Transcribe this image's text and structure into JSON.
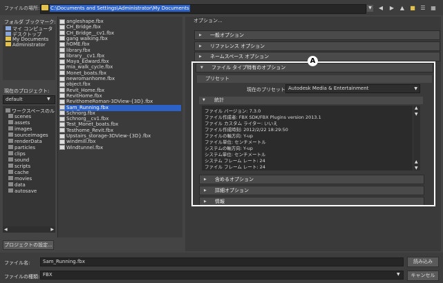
{
  "top": {
    "location_label": "ファイルの場所:",
    "path": "C:\\Documents and Settings\\Administrator\\My Documents"
  },
  "bookmarks": {
    "label": "フォルダ ブックマーク:",
    "items": [
      "マイ コンピュータ",
      "デスクトップ",
      "My Documents",
      "Administrator"
    ]
  },
  "project": {
    "label": "現在のプロジェクト:",
    "selected": "default",
    "tree": [
      "ワークスペースのル",
      "scenes",
      "assets",
      "images",
      "sourceimages",
      "renderData",
      "particles",
      "clips",
      "sound",
      "scripts",
      "cache",
      "movies",
      "data",
      "autosave"
    ],
    "button": "プロジェクトの設定..."
  },
  "files": [
    "angleshape.fbx",
    "CH_Bridge.fbx",
    "CH_Bridge__cv1.fbx",
    "gang walking.fbx",
    "hOME.fbx",
    "library.fbx",
    "library__cv1.fbx",
    "Maya_Edward.fbx",
    "mia_walk_cycle.fbx",
    "Monet_boats.fbx",
    "newromanhome.fbx",
    "object.fbx",
    "Revit_Home.fbx",
    "RevitHome.fbx",
    "RevithomeRoman-3DView-{3D}.fbx",
    "Sam_Running.fbx",
    "Schnorg.fbx",
    "Schnorg__cv1.fbx",
    "Test_Monet_boats.fbx",
    "Testhome_Revit.fbx",
    "Upstairs_storage-3DView-{3D}.fbx",
    "windmill.fbx",
    "Windtunnel.fbx"
  ],
  "selected_file": "Sam_Running.fbx",
  "options": {
    "label": "オプション...",
    "sections": [
      "一般オプション",
      "リファレンス オプション",
      "ネームスペース オプション"
    ],
    "file_type_section": "ファイル タイプ特有のオプション",
    "callout": "A",
    "preset_header": "プリセット",
    "preset_label": "現在のプリセット:",
    "preset_value": "Autodesk Media & Entertainment",
    "stats_header": "統計",
    "stats": [
      "ファイル バージョン: 7.3.0",
      "ファイル作成者: FBX SDK/FBX Plugins version 2013.1",
      "ファイル カスタム ライター: いいえ",
      "ファイル作成時刻: 2012/2/22  18:29:50",
      "ファイルの軸方向: Y-up",
      "ファイル単位: センチメートル",
      "システムの軸方向: Y-up",
      "システム単位: センチメートル",
      "システム フレーム レート: 24",
      "ファイル フレーム レート: 24"
    ],
    "lower_sections": [
      "含めるオプション",
      "詳細オプション",
      "情報"
    ]
  },
  "bottom": {
    "filename_label": "ファイル名:",
    "filename": "Sam_Running.fbx",
    "load_button": "読み込み",
    "filetype_label": "ファイルの種類:",
    "filetype": "FBX",
    "cancel_button": "キャンセル"
  }
}
